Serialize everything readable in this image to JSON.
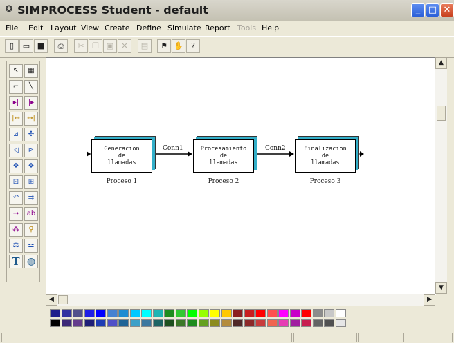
{
  "window": {
    "title": "SIMPROCESS Student - default",
    "app_icon": "simprocess-icon",
    "buttons": {
      "minimize": "_",
      "maximize": "□",
      "close": "✕"
    }
  },
  "menu": [
    {
      "label": "File",
      "enabled": true
    },
    {
      "label": "Edit",
      "enabled": true
    },
    {
      "label": "Layout",
      "enabled": true
    },
    {
      "label": "View",
      "enabled": true
    },
    {
      "label": "Create",
      "enabled": true
    },
    {
      "label": "Define",
      "enabled": true
    },
    {
      "label": "Simulate",
      "enabled": true
    },
    {
      "label": "Report",
      "enabled": true
    },
    {
      "label": "Tools",
      "enabled": false
    },
    {
      "label": "Help",
      "enabled": true
    }
  ],
  "toolbar": [
    {
      "icon": "new-file-icon",
      "glyph": "▯",
      "enabled": true
    },
    {
      "icon": "open-folder-icon",
      "glyph": "▭",
      "enabled": true
    },
    {
      "icon": "save-icon",
      "glyph": "■",
      "enabled": true
    },
    {
      "icon": "print-icon",
      "glyph": "⎙",
      "enabled": true
    },
    {
      "icon": "cut-icon",
      "glyph": "✂",
      "enabled": false
    },
    {
      "icon": "copy-icon",
      "glyph": "❐",
      "enabled": false
    },
    {
      "icon": "paste-icon",
      "glyph": "▣",
      "enabled": false
    },
    {
      "icon": "delete-icon",
      "glyph": "✕",
      "enabled": false
    },
    {
      "icon": "properties-icon",
      "glyph": "▤",
      "enabled": false
    },
    {
      "icon": "run-simulation-icon",
      "glyph": "⚑",
      "enabled": true
    },
    {
      "icon": "stop-simulation-icon",
      "glyph": "✋",
      "enabled": false
    },
    {
      "icon": "help-icon",
      "glyph": "?",
      "enabled": true
    }
  ],
  "palette_tools": [
    {
      "icon": "select-arrow-icon",
      "glyph": "↖"
    },
    {
      "icon": "zoom-select-icon",
      "glyph": "▦"
    },
    {
      "icon": "connector-icon",
      "glyph": "⌐"
    },
    {
      "icon": "line-connector-icon",
      "glyph": "╲"
    },
    {
      "icon": "generate-icon",
      "glyph": "▸|"
    },
    {
      "icon": "dispose-icon",
      "glyph": "|▸"
    },
    {
      "icon": "split-icon",
      "glyph": "|↔"
    },
    {
      "icon": "join-icon",
      "glyph": "↔|"
    },
    {
      "icon": "branch-icon",
      "glyph": "⊿"
    },
    {
      "icon": "merge-icon",
      "glyph": "✣"
    },
    {
      "icon": "assemble-icon",
      "glyph": "◁"
    },
    {
      "icon": "transform-icon",
      "glyph": "⊳"
    },
    {
      "icon": "batch-icon",
      "glyph": "❖"
    },
    {
      "icon": "unbatch-icon",
      "glyph": "❖"
    },
    {
      "icon": "gate-icon",
      "glyph": "⊡"
    },
    {
      "icon": "synchronize-icon",
      "glyph": "⊞"
    },
    {
      "icon": "assign-icon",
      "glyph": "↶"
    },
    {
      "icon": "copy-entity-icon",
      "glyph": "⇉"
    },
    {
      "icon": "delay-icon",
      "glyph": "→"
    },
    {
      "icon": "transfer-icon",
      "glyph": "ab"
    },
    {
      "icon": "resource-icon",
      "glyph": "⁂"
    },
    {
      "icon": "person-icon",
      "glyph": "⚲"
    },
    {
      "icon": "balance-icon",
      "glyph": "⚖"
    },
    {
      "icon": "free-icon",
      "glyph": "⚍"
    },
    {
      "icon": "text-icon",
      "glyph": "T"
    },
    {
      "icon": "global-icon",
      "glyph": "◍"
    }
  ],
  "diagram": {
    "processes": [
      {
        "name": "Generacion\nde\nllamadas",
        "label": "Proceso 1"
      },
      {
        "name": "Procesamiento\nde\nllamadas",
        "label": "Proceso 2"
      },
      {
        "name": "Finalizacion\nde\nllamadas",
        "label": "Proceso 3"
      }
    ],
    "connectors": [
      {
        "label": "Conn1"
      },
      {
        "label": "Conn2"
      }
    ]
  },
  "color_palette": {
    "row1": [
      "#1E1E8C",
      "#3232A0",
      "#50508C",
      "#1E1EE6",
      "#0000FF",
      "#4682D2",
      "#1E8CD2",
      "#00C8FF",
      "#00FFFF",
      "#1EB4B4",
      "#1E8C1E",
      "#32C832",
      "#00FF00",
      "#96FF00",
      "#FFFF00",
      "#FFC800",
      "#8C1E1E",
      "#C81E1E",
      "#FF0000",
      "#FF5050",
      "#FF00FF",
      "#C800C8",
      "#FF0000",
      "#8C8C8C",
      "#C8C8C8",
      "#FFFFFF"
    ],
    "row2": [
      "#000000",
      "#3C2878",
      "#643C8C",
      "#1E1E78",
      "#1E3CB4",
      "#5050C8",
      "#1E6496",
      "#3CA0C8",
      "#3C78A0",
      "#1E6464",
      "#1E501E",
      "#3C7828",
      "#1E8C1E",
      "#64A01E",
      "#8C8C1E",
      "#B48C3C",
      "#502828",
      "#8C2828",
      "#C83C3C",
      "#F06450",
      "#E63CB4",
      "#A01EA0",
      "#C81E50",
      "#646464",
      "#505050",
      "#E6E6E6"
    ]
  }
}
